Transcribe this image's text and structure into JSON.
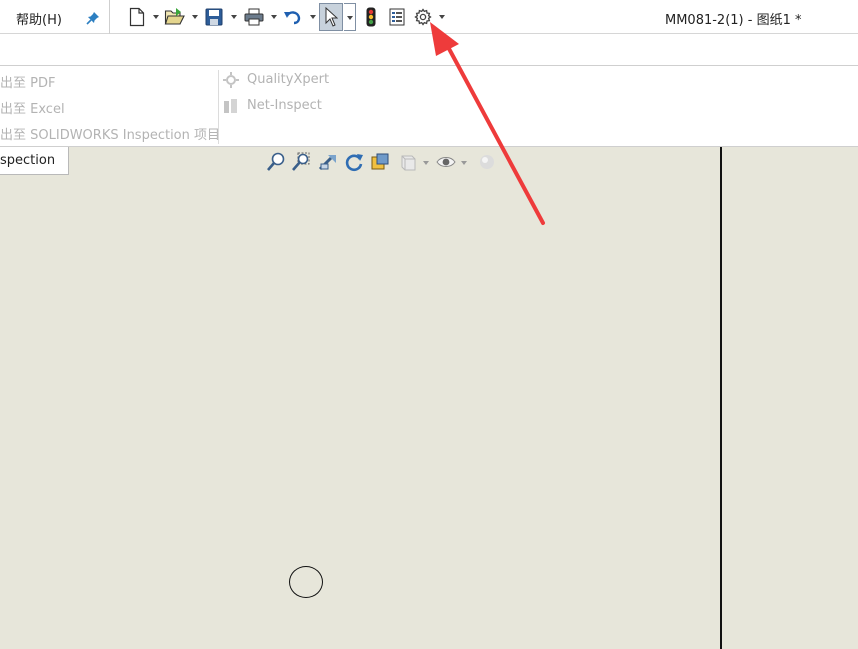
{
  "menu": {
    "help_label": "帮助(H)"
  },
  "toolbar": {
    "buttons": [
      {
        "name": "new-document-icon"
      },
      {
        "name": "open-folder-icon"
      },
      {
        "name": "save-icon"
      },
      {
        "name": "print-icon"
      },
      {
        "name": "undo-icon"
      },
      {
        "name": "select-cursor-icon"
      },
      {
        "name": "rebuild-traffic-light-icon"
      },
      {
        "name": "file-properties-icon"
      },
      {
        "name": "options-gear-icon"
      }
    ]
  },
  "window": {
    "title": "MM081-2(1) - 图纸1 *"
  },
  "ribbon": {
    "left_group": [
      {
        "label": "出至 PDF"
      },
      {
        "label": "出至 Excel"
      },
      {
        "label": "出至 SOLIDWORKS Inspection 项目"
      }
    ],
    "right_group": [
      {
        "label": "QualityXpert"
      },
      {
        "label": "Net-Inspect"
      }
    ]
  },
  "tabs": {
    "active_label": "spection"
  },
  "colors": {
    "canvas": "#e7e6da",
    "ribbon_disabled_text": "#b3b3b3",
    "annotation_arrow": "#ee3b3b",
    "pin_blue": "#2d7fc1"
  }
}
